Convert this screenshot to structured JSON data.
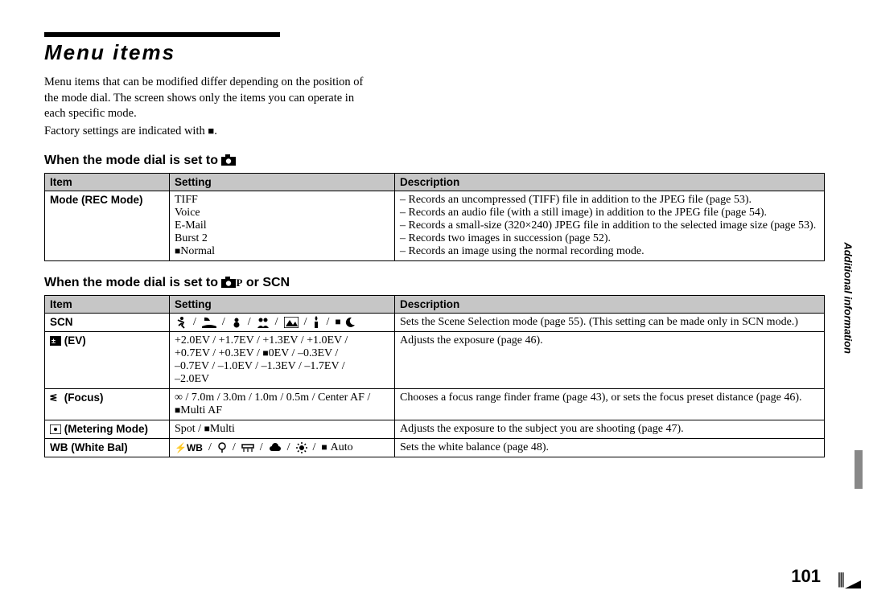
{
  "header": {
    "title": "Menu items"
  },
  "intro": {
    "p1": "Menu items that can be modified differ depending on the position of the mode dial. The screen shows only the items you can operate in each specific mode.",
    "p2_pre": "Factory settings are indicated with ",
    "p2_post": "."
  },
  "section1": {
    "heading_pre": "When the mode dial is set to ",
    "cols": {
      "item": "Item",
      "setting": "Setting",
      "desc": "Description"
    },
    "row": {
      "item": "Mode (REC Mode)",
      "settings": {
        "s1": "TIFF",
        "s2": "Voice",
        "s3": "E-Mail",
        "s4": "Burst 2",
        "s5_post": "Normal"
      },
      "descs": {
        "d1": "Records an uncompressed (TIFF) file in addition to the JPEG file (page 53).",
        "d2": "Records an audio file (with a still image) in addition to the JPEG file (page 54).",
        "d3": "Records a small-size (320×240) JPEG file in addition to the selected image size (page 53).",
        "d4": "Records two images in succession (page 52).",
        "d5": "Records an image using the normal recording mode."
      }
    }
  },
  "section2": {
    "heading_pre": "When the mode dial is set to ",
    "heading_mid": "P",
    "heading_post": " or SCN",
    "cols": {
      "item": "Item",
      "setting": "Setting",
      "desc": "Description"
    },
    "rows": {
      "scn": {
        "item": "SCN",
        "desc": "Sets the Scene Selection mode (page 55). (This setting can be made only in SCN mode.)"
      },
      "ev": {
        "item_post": " (EV)",
        "setting_l1": "+2.0EV / +1.7EV / +1.3EV / +1.0EV /",
        "setting_l2_pre": "+0.7EV / +0.3EV / ",
        "setting_l2_post": "0EV / –0.3EV /",
        "setting_l3": "–0.7EV / –1.0EV / –1.3EV / –1.7EV /",
        "setting_l4": "–2.0EV",
        "desc": "Adjusts the exposure (page 46)."
      },
      "focus": {
        "item_post": " (Focus)",
        "setting_l1": "∞ / 7.0m / 3.0m / 1.0m / 0.5m / Center AF /",
        "setting_l2_post": "Multi AF",
        "desc": "Chooses a focus range finder frame (page 43), or sets the focus preset distance (page 46)."
      },
      "meter": {
        "item_post": " (Metering Mode)",
        "setting_pre": "Spot / ",
        "setting_post": "Multi",
        "desc": "Adjusts the exposure to the subject you are shooting (page 47)."
      },
      "wb": {
        "item": "WB (White Bal)",
        "setting_wbtext": "WB",
        "setting_auto": "Auto",
        "desc": "Sets the white balance (page 48)."
      }
    }
  },
  "page_number": "101",
  "side_label": "Additional information"
}
